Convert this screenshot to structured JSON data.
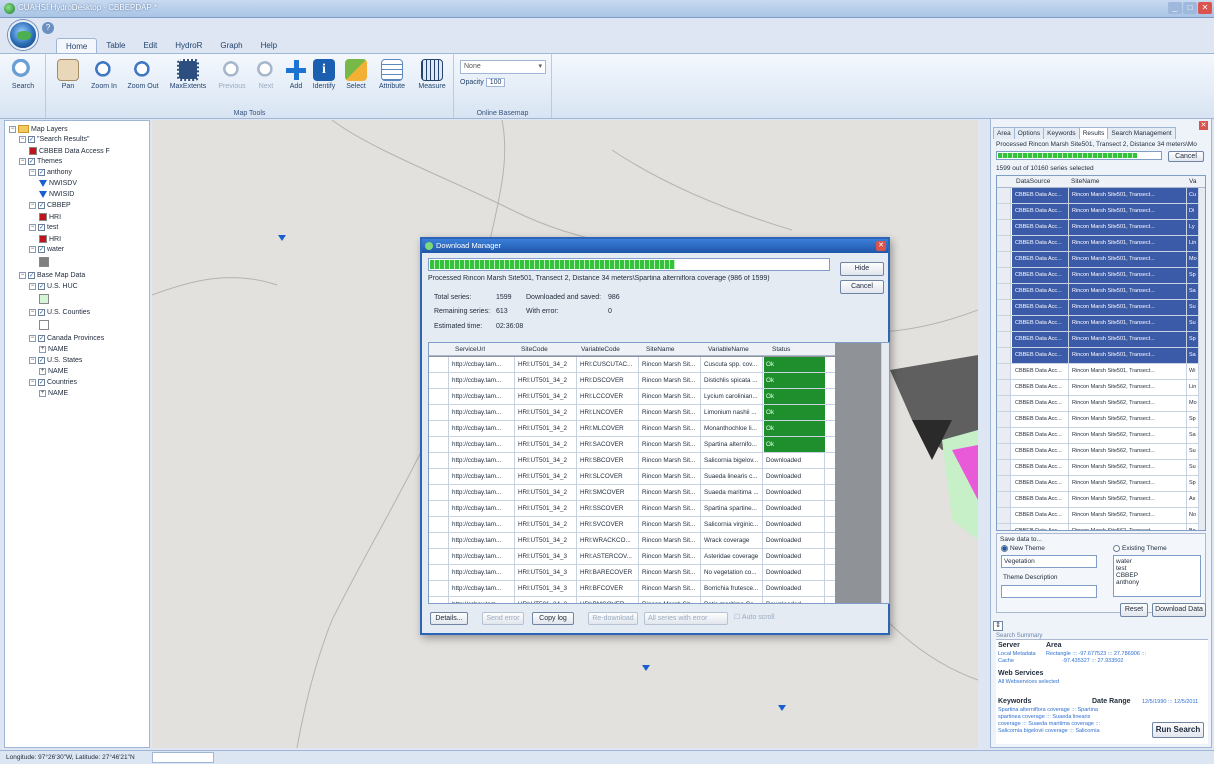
{
  "window": {
    "title": "CUAHSI HydroDesktop - CBBEPDAP *",
    "min": "_",
    "max": "□",
    "close": "✕"
  },
  "ribbon": {
    "tabs": [
      "Home",
      "Table",
      "Edit",
      "HydroR",
      "Graph",
      "Help"
    ],
    "search_label": "Search",
    "tools": [
      "Pan",
      "Zoom In",
      "Zoom Out",
      "MaxExtents",
      "Previous",
      "Next",
      "Add",
      "Identify",
      "Select",
      "Attribute",
      "Measure"
    ],
    "map_tools_label": "Map Tools",
    "basemap_value": "None",
    "opacity_label": "Opacity",
    "opacity_value": "100",
    "online_basemap_label": "Online Basemap"
  },
  "layers": {
    "root": "Map Layers",
    "items": [
      {
        "label": "\"Search Results\"",
        "level": 1,
        "type": "group"
      },
      {
        "label": "CBBEB Data Access F",
        "level": 2,
        "type": "swatch",
        "color": "#c0131a"
      },
      {
        "label": "Themes",
        "level": 1,
        "type": "group"
      },
      {
        "label": "anthony",
        "level": 2,
        "type": "group"
      },
      {
        "label": "NWISDV",
        "level": 3,
        "type": "point"
      },
      {
        "label": "NWISID",
        "level": 3,
        "type": "point"
      },
      {
        "label": "CBBEP",
        "level": 2,
        "type": "group"
      },
      {
        "label": "HRI",
        "level": 3,
        "type": "swatch",
        "color": "#c0131a"
      },
      {
        "label": "test",
        "level": 2,
        "type": "group"
      },
      {
        "label": "HRI",
        "level": 3,
        "type": "swatch",
        "color": "#c0131a"
      },
      {
        "label": "water",
        "level": 2,
        "type": "group"
      },
      {
        "label": "",
        "level": 3,
        "type": "swatch",
        "color": "#808080"
      },
      {
        "label": "Base Map Data",
        "level": 1,
        "type": "group"
      },
      {
        "label": "U.S. HUC",
        "level": 2,
        "type": "group"
      },
      {
        "label": "",
        "level": 3,
        "type": "swatch",
        "color": "#d6f5d6"
      },
      {
        "label": "U.S. Counties",
        "level": 2,
        "type": "group"
      },
      {
        "label": "",
        "level": 3,
        "type": "swatch",
        "color": "#ffffff"
      },
      {
        "label": "Canada Provinces",
        "level": 2,
        "type": "group"
      },
      {
        "label": "NAME",
        "level": 3,
        "type": "field"
      },
      {
        "label": "U.S. States",
        "level": 2,
        "type": "group"
      },
      {
        "label": "NAME",
        "level": 3,
        "type": "field"
      },
      {
        "label": "Countries",
        "level": 2,
        "type": "group"
      },
      {
        "label": "NAME",
        "level": 3,
        "type": "field"
      }
    ]
  },
  "search_panel": {
    "tabs": [
      "Area",
      "Options",
      "Keywords",
      "Results",
      "Search Management"
    ],
    "active_tab": "Results",
    "status": "Processed Rincon Marsh Site501, Transect 2, Distance 34 meters\\Mo",
    "progress": 0.86,
    "cancel_label": "Cancel",
    "count": "1599 out of 10160 series selected",
    "columns": [
      "DataSource",
      "SiteName",
      "Va"
    ],
    "rows": [
      {
        "src": "CBBEB Data Acc...",
        "site": "Rincon Marsh Site501, Transect...",
        "va": "Cu",
        "hl": true
      },
      {
        "src": "CBBEB Data Acc...",
        "site": "Rincon Marsh Site501, Transect...",
        "va": "Di",
        "hl": true
      },
      {
        "src": "CBBEB Data Acc...",
        "site": "Rincon Marsh Site501, Transect...",
        "va": "Ly",
        "hl": true
      },
      {
        "src": "CBBEB Data Acc...",
        "site": "Rincon Marsh Site501, Transect...",
        "va": "Lin",
        "hl": true
      },
      {
        "src": "CBBEB Data Acc...",
        "site": "Rincon Marsh Site501, Transect...",
        "va": "Mo",
        "hl": true
      },
      {
        "src": "CBBEB Data Acc...",
        "site": "Rincon Marsh Site501, Transect...",
        "va": "Sp",
        "hl": true
      },
      {
        "src": "CBBEB Data Acc...",
        "site": "Rincon Marsh Site501, Transect...",
        "va": "Sa",
        "hl": true
      },
      {
        "src": "CBBEB Data Acc...",
        "site": "Rincon Marsh Site501, Transect...",
        "va": "Su",
        "hl": true
      },
      {
        "src": "CBBEB Data Acc...",
        "site": "Rincon Marsh Site501, Transect...",
        "va": "Su",
        "hl": true
      },
      {
        "src": "CBBEB Data Acc...",
        "site": "Rincon Marsh Site501, Transect...",
        "va": "Sp",
        "hl": true
      },
      {
        "src": "CBBEB Data Acc...",
        "site": "Rincon Marsh Site501, Transect...",
        "va": "Sa",
        "hl": true
      },
      {
        "src": "CBBEB Data Acc...",
        "site": "Rincon Marsh Site501, Transect...",
        "va": "Wi",
        "hl": false
      },
      {
        "src": "CBBEB Data Acc...",
        "site": "Rincon Marsh Site562, Transect...",
        "va": "Lin",
        "hl": false
      },
      {
        "src": "CBBEB Data Acc...",
        "site": "Rincon Marsh Site562, Transect...",
        "va": "Mo",
        "hl": false
      },
      {
        "src": "CBBEB Data Acc...",
        "site": "Rincon Marsh Site562, Transect...",
        "va": "Sp",
        "hl": false
      },
      {
        "src": "CBBEB Data Acc...",
        "site": "Rincon Marsh Site562, Transect...",
        "va": "Sa",
        "hl": false
      },
      {
        "src": "CBBEB Data Acc...",
        "site": "Rincon Marsh Site562, Transect...",
        "va": "Su",
        "hl": false
      },
      {
        "src": "CBBEB Data Acc...",
        "site": "Rincon Marsh Site562, Transect...",
        "va": "Su",
        "hl": false
      },
      {
        "src": "CBBEB Data Acc...",
        "site": "Rincon Marsh Site562, Transect...",
        "va": "Sp",
        "hl": false
      },
      {
        "src": "CBBEB Data Acc...",
        "site": "Rincon Marsh Site562, Transect...",
        "va": "As",
        "hl": false
      },
      {
        "src": "CBBEB Data Acc...",
        "site": "Rincon Marsh Site562, Transect...",
        "va": "No",
        "hl": false
      },
      {
        "src": "CBBEB Data Acc...",
        "site": "Rincon Marsh Site562, Transect...",
        "va": "Bo",
        "hl": false
      },
      {
        "src": "CBBEB Data Acc...",
        "site": "Rincon Marsh Site562, Transect...",
        "va": "Ba",
        "hl": false
      },
      {
        "src": "CBBEB Data Acc...",
        "site": "Rincon Marsh Site562, Transect...",
        "va": "Cu",
        "hl": false
      }
    ],
    "save_label": "Save data to...",
    "new_theme": "New Theme",
    "existing_theme": "Existing Theme",
    "theme_name_value": "Vegetation",
    "theme_desc_label": "Theme Description",
    "existing_themes": [
      "water",
      "test",
      "CBBEP",
      "anthony"
    ],
    "reset_label": "Reset",
    "download_label": "Download Data",
    "summary_title": "Search Summary",
    "server_h": "Server",
    "server_v1": "Local Metadata",
    "server_v2": "Cache",
    "area_h": "Area",
    "area_v1": "Rectangle ::: -97.677523 ::: 27.786906 :::",
    "area_v2": "-97.435327 ::: 27.933502",
    "ws_h": "Web Services",
    "ws_v": "All Webservices selected",
    "kw_h": "Keywords",
    "kw_v1": "Spartina alterniflora coverage ::: Spartina",
    "kw_v2": "spartinea coverage ::: Suaeda linearis",
    "kw_v3": "coverage ::: Suaeda maritima coverage :::",
    "kw_v4": "Salicornia bigelovii coverage ::: Salicornia",
    "dr_h": "Date Range",
    "dr_v": "12/5/1990 ::: 12/5/2011",
    "run_label": "Run Search"
  },
  "download_manager": {
    "title": "Download Manager",
    "progress": 0.617,
    "status": "Processed Rincon Marsh Site501, Transect 2, Distance 34 meters\\Spartina alterniflora coverage (986 of 1599)",
    "hide_label": "Hide",
    "cancel_label": "Cancel",
    "total_label": "Total series:",
    "total_value": "1599",
    "downloaded_label": "Downloaded and saved:",
    "downloaded_value": "986",
    "remaining_label": "Remaining series:",
    "remaining_value": "613",
    "error_label": "With error:",
    "error_value": "0",
    "time_label": "Estimated time:",
    "time_value": "02:36:08",
    "columns": [
      "ServiceUrl",
      "SiteCode",
      "VariableCode",
      "SiteName",
      "VariableName",
      "Status"
    ],
    "rows": [
      {
        "url": "http://ccbay.tam...",
        "site": "HRI:UT501_34_2",
        "var": "HRI:CUSCUTAC...",
        "name": "Rincon Marsh Sit...",
        "vname": "Cuscuta spp. cov...",
        "status": "Ok",
        "ok": true
      },
      {
        "url": "http://ccbay.tam...",
        "site": "HRI:UT501_34_2",
        "var": "HRI:DSCOVER",
        "name": "Rincon Marsh Sit...",
        "vname": "Distichlis spicata ...",
        "status": "Ok",
        "ok": true
      },
      {
        "url": "http://ccbay.tam...",
        "site": "HRI:UT501_34_2",
        "var": "HRI:LCCOVER",
        "name": "Rincon Marsh Sit...",
        "vname": "Lycium carolinian...",
        "status": "Ok",
        "ok": true
      },
      {
        "url": "http://ccbay.tam...",
        "site": "HRI:UT501_34_2",
        "var": "HRI:LNCOVER",
        "name": "Rincon Marsh Sit...",
        "vname": "Limonium nashii ...",
        "status": "Ok",
        "ok": true
      },
      {
        "url": "http://ccbay.tam...",
        "site": "HRI:UT501_34_2",
        "var": "HRI:MLCOVER",
        "name": "Rincon Marsh Sit...",
        "vname": "Monanthochloe li...",
        "status": "Ok",
        "ok": true
      },
      {
        "url": "http://ccbay.tam...",
        "site": "HRI:UT501_34_2",
        "var": "HRI:SACOVER",
        "name": "Rincon Marsh Sit...",
        "vname": "Spartina alternifo...",
        "status": "Ok",
        "ok": true
      },
      {
        "url": "http://ccbay.tam...",
        "site": "HRI:UT501_34_2",
        "var": "HRI:SBCOVER",
        "name": "Rincon Marsh Sit...",
        "vname": "Salicornia bigelov...",
        "status": "Downloaded",
        "ok": false
      },
      {
        "url": "http://ccbay.tam...",
        "site": "HRI:UT501_34_2",
        "var": "HRI:SLCOVER",
        "name": "Rincon Marsh Sit...",
        "vname": "Suaeda linearis c...",
        "status": "Downloaded",
        "ok": false
      },
      {
        "url": "http://ccbay.tam...",
        "site": "HRI:UT501_34_2",
        "var": "HRI:SMCOVER",
        "name": "Rincon Marsh Sit...",
        "vname": "Suaeda maritima ...",
        "status": "Downloaded",
        "ok": false
      },
      {
        "url": "http://ccbay.tam...",
        "site": "HRI:UT501_34_2",
        "var": "HRI:SSCOVER",
        "name": "Rincon Marsh Sit...",
        "vname": "Spartina spartine...",
        "status": "Downloaded",
        "ok": false
      },
      {
        "url": "http://ccbay.tam...",
        "site": "HRI:UT501_34_2",
        "var": "HRI:SVCOVER",
        "name": "Rincon Marsh Sit...",
        "vname": "Salicornia virginic...",
        "status": "Downloaded",
        "ok": false
      },
      {
        "url": "http://ccbay.tam...",
        "site": "HRI:UT501_34_2",
        "var": "HRI:WRACKCO...",
        "name": "Rincon Marsh Sit...",
        "vname": "Wrack coverage",
        "status": "Downloaded",
        "ok": false
      },
      {
        "url": "http://ccbay.tam...",
        "site": "HRI:UT501_34_3",
        "var": "HRI:ASTERCOV...",
        "name": "Rincon Marsh Sit...",
        "vname": "Asteridae coverage",
        "status": "Downloaded",
        "ok": false
      },
      {
        "url": "http://ccbay.tam...",
        "site": "HRI:UT501_34_3",
        "var": "HRI:BARECOVER",
        "name": "Rincon Marsh Sit...",
        "vname": "No vegetation co...",
        "status": "Downloaded",
        "ok": false
      },
      {
        "url": "http://ccbay.tam...",
        "site": "HRI:UT501_34_3",
        "var": "HRI:BFCOVER",
        "name": "Rincon Marsh Sit...",
        "vname": "Borrichia frutesce...",
        "status": "Downloaded",
        "ok": false
      },
      {
        "url": "http://ccbay.tam...",
        "site": "HRI:UT501_34_3",
        "var": "HRI:BMCOVER",
        "name": "Rincon Marsh Sit...",
        "vname": "Batis maritima Co...",
        "status": "Downloaded",
        "ok": false
      },
      {
        "url": "http://ccbay.tam...",
        "site": "HRI:UT501_34_3",
        "var": "HRI:CUSCUTAC...",
        "name": "Rincon Marsh Sit...",
        "vname": "Cuscuta spp. cov...",
        "status": "Downloaded",
        "ok": false
      },
      {
        "url": "http://ccbay.tam...",
        "site": "HRI:UT501_34_3",
        "var": "HRI:DSCOVER",
        "name": "Rincon Marsh Sit...",
        "vname": "Distichlis spicata",
        "status": "Downloaded",
        "ok": false
      }
    ],
    "details_label": "Details...",
    "send_error_label": "Send error",
    "copy_log_label": "Copy log",
    "redownload_label": "Re-download",
    "filter_value": "All series with error",
    "auto_scroll_label": "Auto scroll"
  },
  "statusbar": {
    "coords": "Longitude: 97°26'30\"W, Latitude: 27°46'21\"N"
  }
}
